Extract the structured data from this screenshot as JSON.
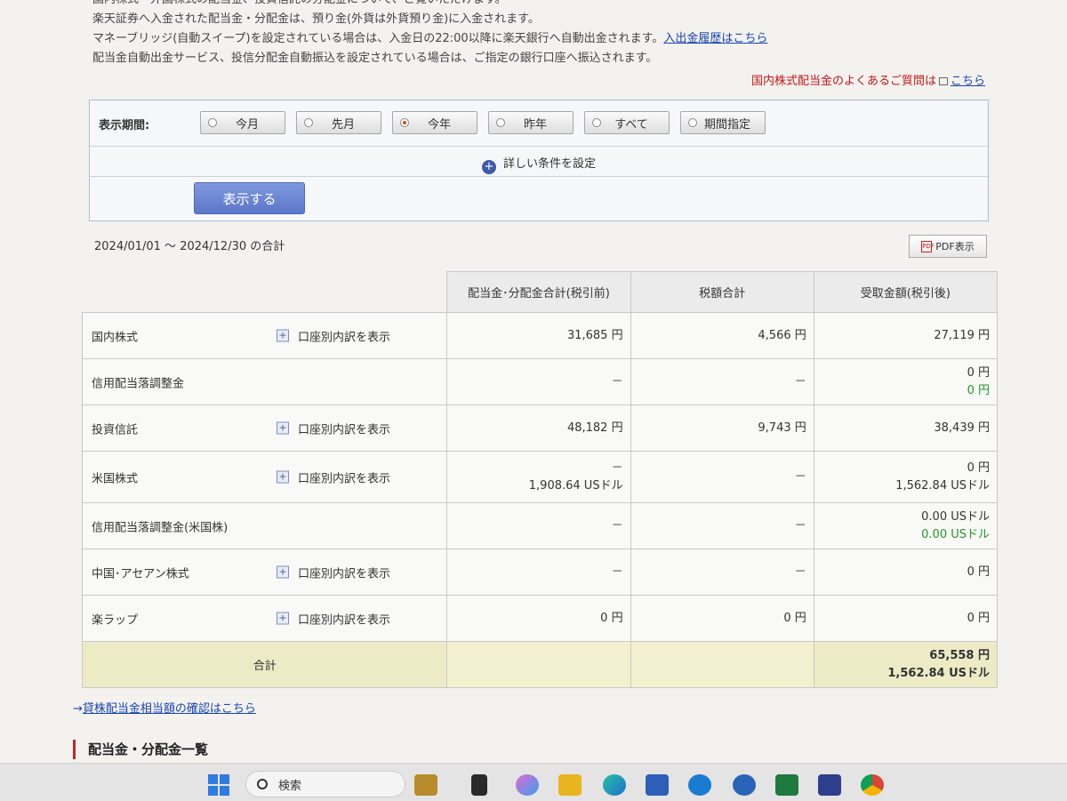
{
  "notes": {
    "line1": "国内株式・外国株式の配当金、投資信託の分配金について、ご覧いただけます。",
    "line2": "楽天証券へ入金された配当金・分配金は、預り金(外貨は外貨預り金)に入金されます。",
    "line3": "マネーブリッジ(自動スイープ)を設定されている場合は、入金日の22:00以降に楽天銀行へ自動出金されます。",
    "line3_link": "入出金履歴はこちら",
    "line4": "配当金自動出金サービス、投信分配金自動振込を設定されている場合は、ご指定の銀行口座へ振込されます。"
  },
  "faq": {
    "text": "国内株式配当金のよくあるご質問は",
    "link": "こちら"
  },
  "filter": {
    "period_label": "表示期間:",
    "periods": [
      "今月",
      "先月",
      "今年",
      "昨年",
      "すべて",
      "期間指定"
    ],
    "selected": "今年",
    "detail_label": "詳しい条件を設定",
    "show_button": "表示する"
  },
  "range": "2024/01/01 ～ 2024/12/30 の合計",
  "pdf_button": "PDF表示",
  "pdf_icon_text": "PDF",
  "table": {
    "headers": [
      "配当金･分配金合計(税引前)",
      "税額合計",
      "受取金額(税引後)"
    ],
    "breakdown_label": "口座別内訳を表示",
    "rows": [
      {
        "name": "国内株式",
        "expandable": true,
        "pre": "31,685 円",
        "pre2": "",
        "tax": "4,566 円",
        "net": "27,119 円",
        "net2": "",
        "net2_green": false
      },
      {
        "name": "信用配当落調整金",
        "expandable": false,
        "pre": "－",
        "pre2": "",
        "tax": "－",
        "net": "0 円",
        "net2": "0 円",
        "net2_green": true
      },
      {
        "name": "投資信託",
        "expandable": true,
        "pre": "48,182 円",
        "pre2": "",
        "tax": "9,743 円",
        "net": "38,439 円",
        "net2": "",
        "net2_green": false
      },
      {
        "name": "米国株式",
        "expandable": true,
        "pre": "－",
        "pre2": "1,908.64 USドル",
        "tax": "－",
        "net": "0 円",
        "net2": "1,562.84 USドル",
        "net2_green": false
      },
      {
        "name": "信用配当落調整金(米国株)",
        "expandable": false,
        "pre": "－",
        "pre2": "",
        "tax": "－",
        "net": "0.00 USドル",
        "net2": "0.00 USドル",
        "net2_green": true
      },
      {
        "name": "中国･アセアン株式",
        "expandable": true,
        "pre": "－",
        "pre2": "",
        "tax": "－",
        "net": "0 円",
        "net2": "",
        "net2_green": false
      },
      {
        "name": "楽ラップ",
        "expandable": true,
        "pre": "0 円",
        "pre2": "",
        "tax": "0 円",
        "net": "0 円",
        "net2": "",
        "net2_green": false
      }
    ],
    "total": {
      "label": "合計",
      "net": "65,558 円",
      "net2": "1,562.84 USドル"
    }
  },
  "loan_link": "貸株配当金相当額の確認はこちら",
  "section_title": "配当金・分配金一覧",
  "taskbar": {
    "search_placeholder": "検索"
  },
  "colors": {
    "accent": "#5c77c9",
    "link": "#1a45b0",
    "alert": "#c21818",
    "total_bg": "#ecebc6",
    "green": "#1f9a1f"
  }
}
